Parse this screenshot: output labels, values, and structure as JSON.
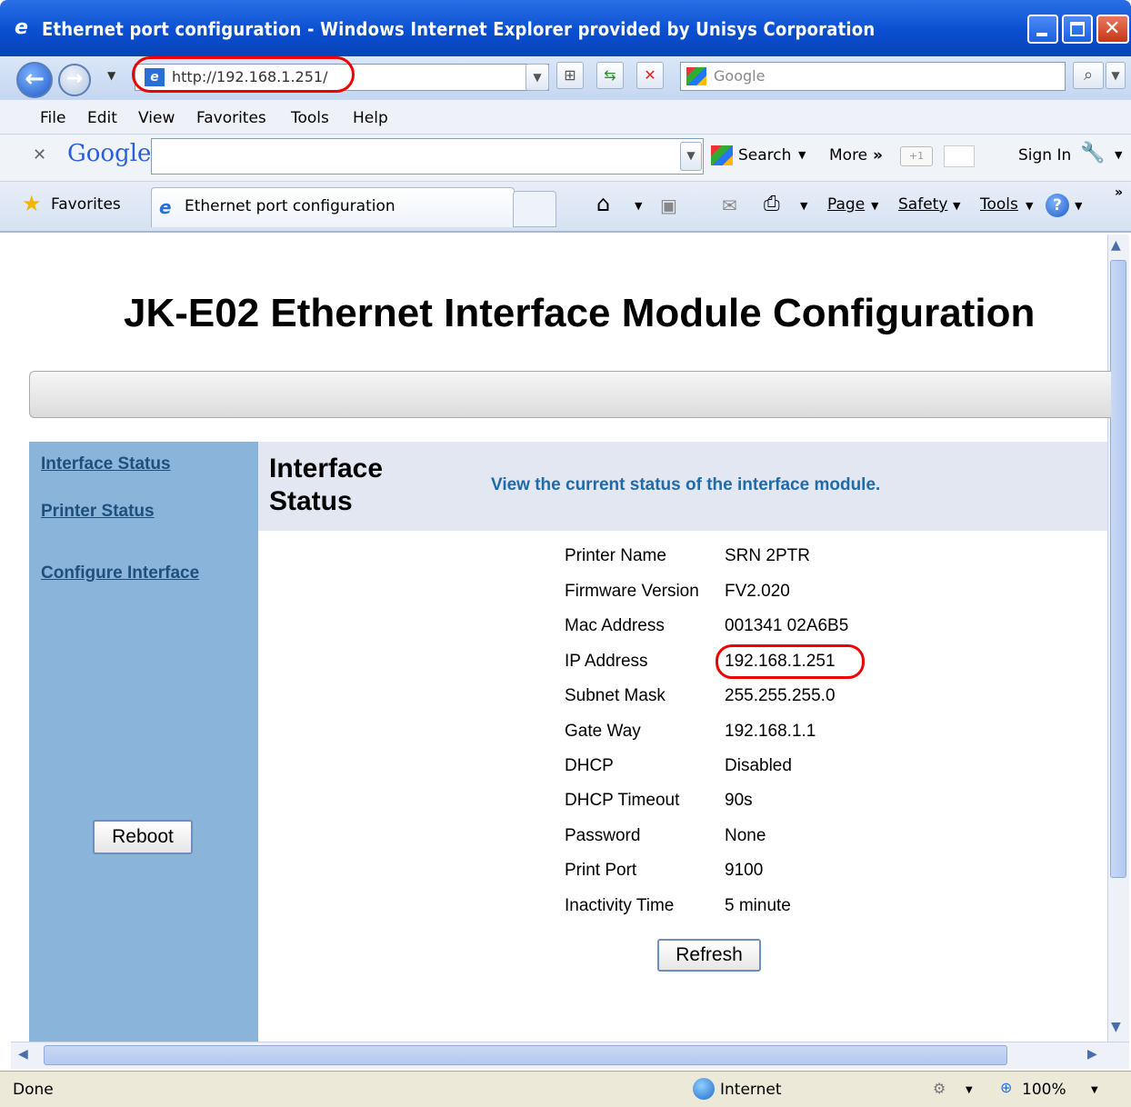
{
  "window": {
    "title": "Ethernet port configuration - Windows Internet Explorer provided by Unisys Corporation"
  },
  "address_bar": {
    "url": "http://192.168.1.251/",
    "search_placeholder": "Google"
  },
  "menu": [
    "File",
    "Edit",
    "View",
    "Favorites",
    "Tools",
    "Help"
  ],
  "google_toolbar": {
    "logo": "Google",
    "search_label": "Search",
    "more_label": "More",
    "sign_in_label": "Sign In"
  },
  "tabs": {
    "favorites_label": "Favorites",
    "active_tab": "Ethernet port configuration"
  },
  "commands": {
    "page": "Page",
    "safety": "Safety",
    "tools": "Tools"
  },
  "page": {
    "heading": "JK-E02 Ethernet Interface Module Configuration",
    "sidebar": {
      "links": [
        "Interface Status",
        "Printer Status",
        "Configure Interface"
      ],
      "reboot_label": "Reboot"
    },
    "section": {
      "title": "Interface Status",
      "description": "View the current status of the interface module."
    },
    "status_rows": [
      {
        "label": "Printer Name",
        "value": "SRN 2PTR"
      },
      {
        "label": "Firmware Version",
        "value": "FV2.020"
      },
      {
        "label": "Mac Address",
        "value": "001341 02A6B5"
      },
      {
        "label": "IP Address",
        "value": "192.168.1.251"
      },
      {
        "label": "Subnet Mask",
        "value": "255.255.255.0"
      },
      {
        "label": "Gate Way",
        "value": "192.168.1.1"
      },
      {
        "label": "DHCP",
        "value": "Disabled"
      },
      {
        "label": "DHCP Timeout",
        "value": "90s"
      },
      {
        "label": "Password",
        "value": "None"
      },
      {
        "label": "Print Port",
        "value": "9100"
      },
      {
        "label": "Inactivity Time",
        "value": "5 minute"
      }
    ],
    "refresh_label": "Refresh"
  },
  "status_bar": {
    "left": "Done",
    "zone": "Internet",
    "zoom": "100%"
  },
  "colors": {
    "titlebar": "#0a4fd1",
    "sidebar": "#8ab4da",
    "banner": "#e2e7f1",
    "highlight_oval": "#ee0000",
    "link": "#1f4f7d"
  }
}
